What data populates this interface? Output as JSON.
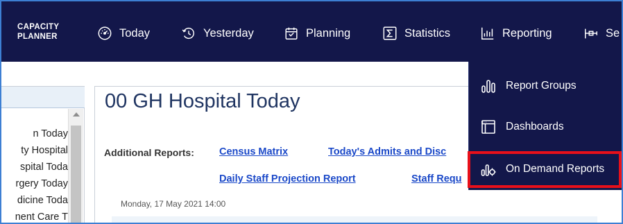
{
  "brand": {
    "line1": "CAPACITY",
    "line2": "PLANNER"
  },
  "nav": [
    {
      "label": "Today",
      "icon": "speedometer-icon"
    },
    {
      "label": "Yesterday",
      "icon": "history-icon"
    },
    {
      "label": "Planning",
      "icon": "calendar-icon"
    },
    {
      "label": "Statistics",
      "icon": "sigma-icon"
    },
    {
      "label": "Reporting",
      "icon": "bar-chart-icon"
    },
    {
      "label": "Se",
      "icon": "settings-icon"
    }
  ],
  "left_tree": [
    "n Today",
    "ty Hospital",
    "spital Toda",
    "rgery Today",
    "dicine Toda",
    "nent Care T"
  ],
  "main": {
    "title": "00 GH Hospital Today",
    "additional_reports_label": "Additional Reports:",
    "links": {
      "census_matrix": "Census Matrix",
      "admits": "Today's Admits and Disc",
      "daily_staff": "Daily Staff Projection Report",
      "staff_req": "Staff Requ"
    },
    "datetime": "Monday, 17 May 2021 14:00"
  },
  "reporting_menu": {
    "items": [
      {
        "label": "Report Groups",
        "icon": "report-groups-icon"
      },
      {
        "label": "Dashboards",
        "icon": "dashboard-icon"
      },
      {
        "label": "On Demand Reports",
        "icon": "on-demand-reports-icon"
      }
    ],
    "highlighted_item": "On Demand Reports",
    "highlight_color": "#e8101a"
  },
  "colors": {
    "nav_bg": "#13174a",
    "link": "#1a48c8",
    "title": "#1f3461",
    "frame_border": "#3d7fd3"
  }
}
